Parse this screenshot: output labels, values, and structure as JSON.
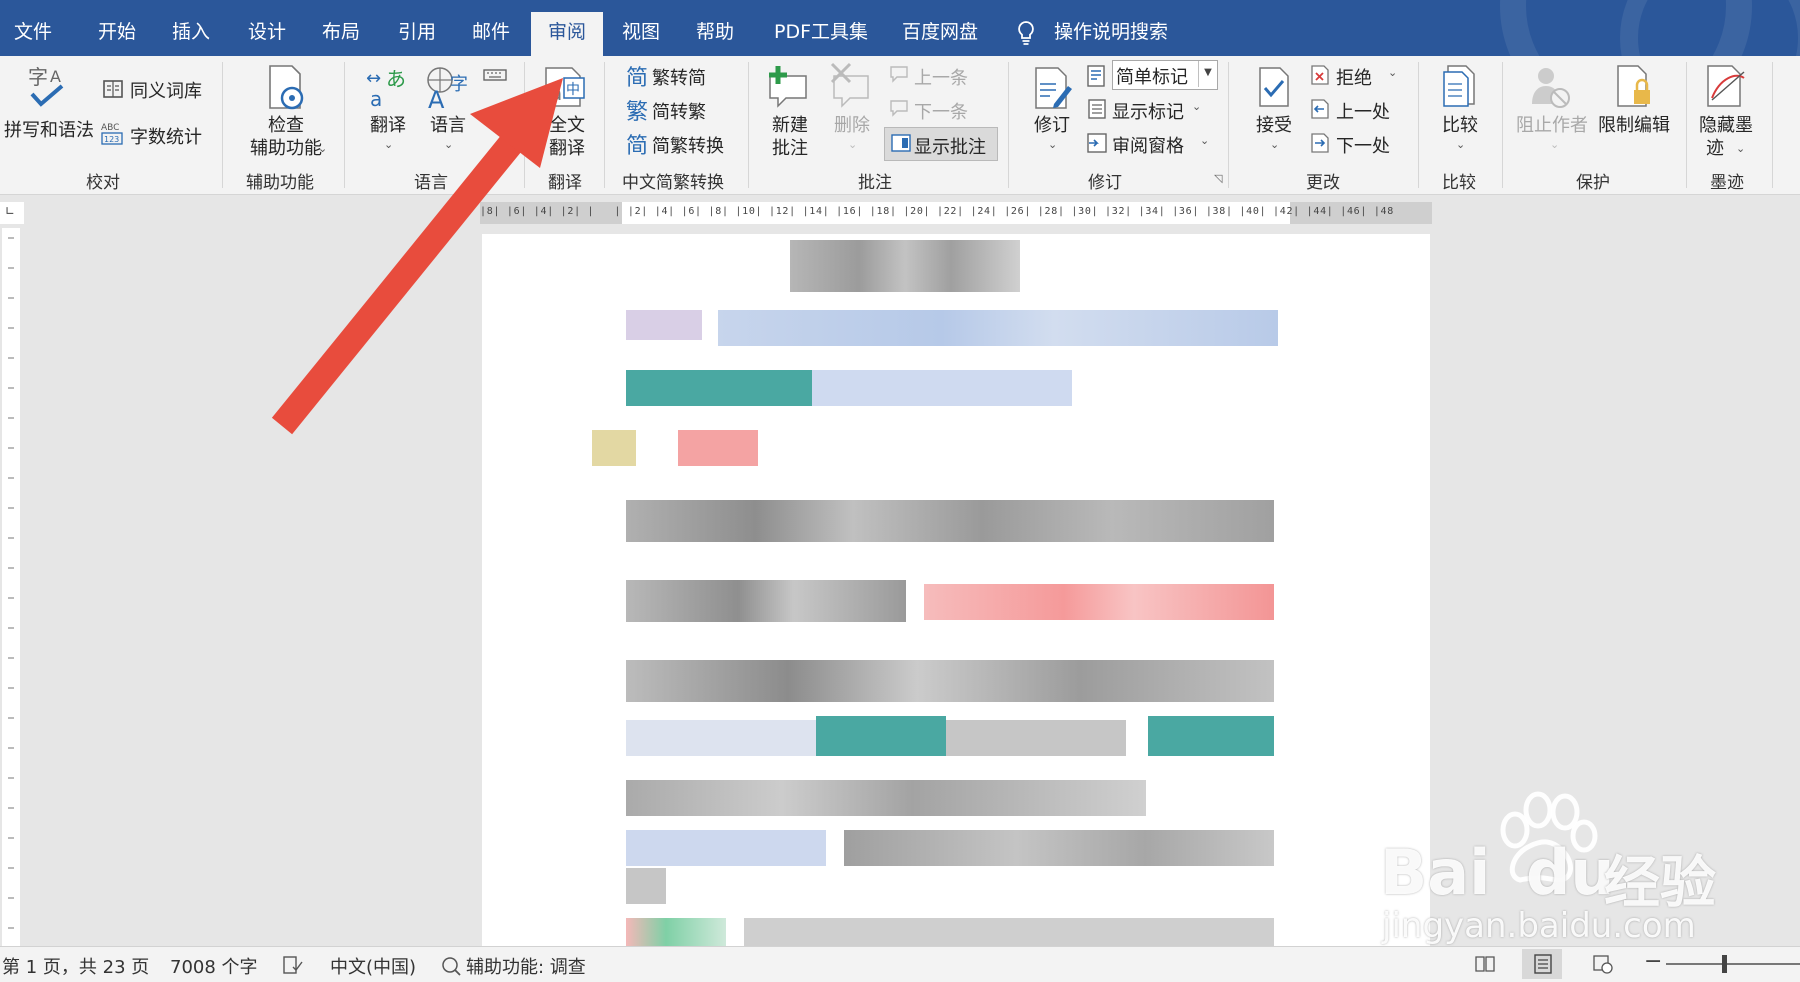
{
  "tabs": [
    "文件",
    "开始",
    "插入",
    "设计",
    "布局",
    "引用",
    "邮件",
    "审阅",
    "视图",
    "帮助",
    "PDF工具集",
    "百度网盘"
  ],
  "active_tab": "审阅",
  "search_label": "操作说明搜索",
  "ribbon": {
    "proofing": {
      "spelling": "拼写和语法",
      "thesaurus": "同义词库",
      "wordcount": "字数统计",
      "label": "校对"
    },
    "accessibility": {
      "check_line1": "检查",
      "check_line2": "辅助功能",
      "label": "辅助功能"
    },
    "language": {
      "translate": "翻译",
      "language": "语言",
      "label": "语言"
    },
    "translation": {
      "full_line1": "全文",
      "full_line2": "翻译",
      "label": "翻译"
    },
    "chinese": {
      "to_simplified": "繁转简",
      "to_traditional": "简转繁",
      "convert": "简繁转换",
      "label": "中文简繁转换"
    },
    "comments": {
      "new_line1": "新建",
      "new_line2": "批注",
      "delete": "删除",
      "previous": "上一条",
      "next": "下一条",
      "show": "显示批注",
      "label": "批注"
    },
    "tracking": {
      "track": "修订",
      "markup_select": "简单标记",
      "show_markup": "显示标记",
      "reviewing_pane": "审阅窗格",
      "label": "修订"
    },
    "changes": {
      "accept": "接受",
      "reject": "拒绝",
      "previous": "上一处",
      "next": "下一处",
      "label": "更改"
    },
    "compare": {
      "compare": "比较",
      "label": "比较"
    },
    "protect": {
      "block_authors": "阻止作者",
      "restrict": "限制编辑",
      "label": "保护"
    },
    "ink": {
      "hide_line1": "隐藏墨",
      "hide_line2": "迹",
      "label": "墨迹"
    }
  },
  "ruler_text": "|8| |6| |4| |2| |   | |2| |4| |6| |8| |10| |12| |14| |16| |18| |20| |22| |24| |26| |28| |30| |32| |34| |36| |38| |40| |42| |44| |46| |48",
  "status": {
    "page": "第 1 页，共 23 页",
    "words": "7008 个字",
    "language": "中文(中国)",
    "accessibility": "辅助功能: 调查"
  },
  "watermark": {
    "brand": "Bai",
    "brand2": "du",
    "cn": "经验",
    "url": "jingyan.baidu.com"
  },
  "colors": {
    "tab_bar": "#2b579a",
    "arrow": "#e84c3d",
    "ribbon": "#f3f3f3"
  }
}
